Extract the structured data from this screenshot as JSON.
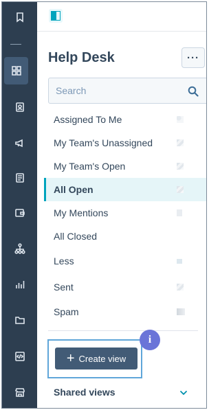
{
  "sidebar": {
    "icons": [
      "bookmark-icon",
      "grid-icon",
      "contacts-icon",
      "megaphone-icon",
      "document-icon",
      "wallet-icon",
      "org-chart-icon",
      "bar-chart-icon",
      "folder-icon",
      "code-icon",
      "storefront-icon"
    ]
  },
  "panel": {
    "title": "Help Desk",
    "more_label": "···",
    "search": {
      "placeholder": "Search"
    },
    "views": [
      {
        "label": "Assigned To Me"
      },
      {
        "label": "My Team's Unassigned"
      },
      {
        "label": "My Team's Open"
      },
      {
        "label": "All Open",
        "active": true
      },
      {
        "label": "My Mentions"
      },
      {
        "label": "All Closed"
      },
      {
        "label": "Less"
      },
      {
        "label": "Sent"
      },
      {
        "label": "Spam"
      }
    ],
    "create_view_label": "Create view",
    "info_badge": "i",
    "shared_views_label": "Shared views"
  },
  "colors": {
    "rail": "#2d3e50",
    "accent": "#00a4bd",
    "button": "#425b76",
    "badge": "#6a74d8"
  }
}
